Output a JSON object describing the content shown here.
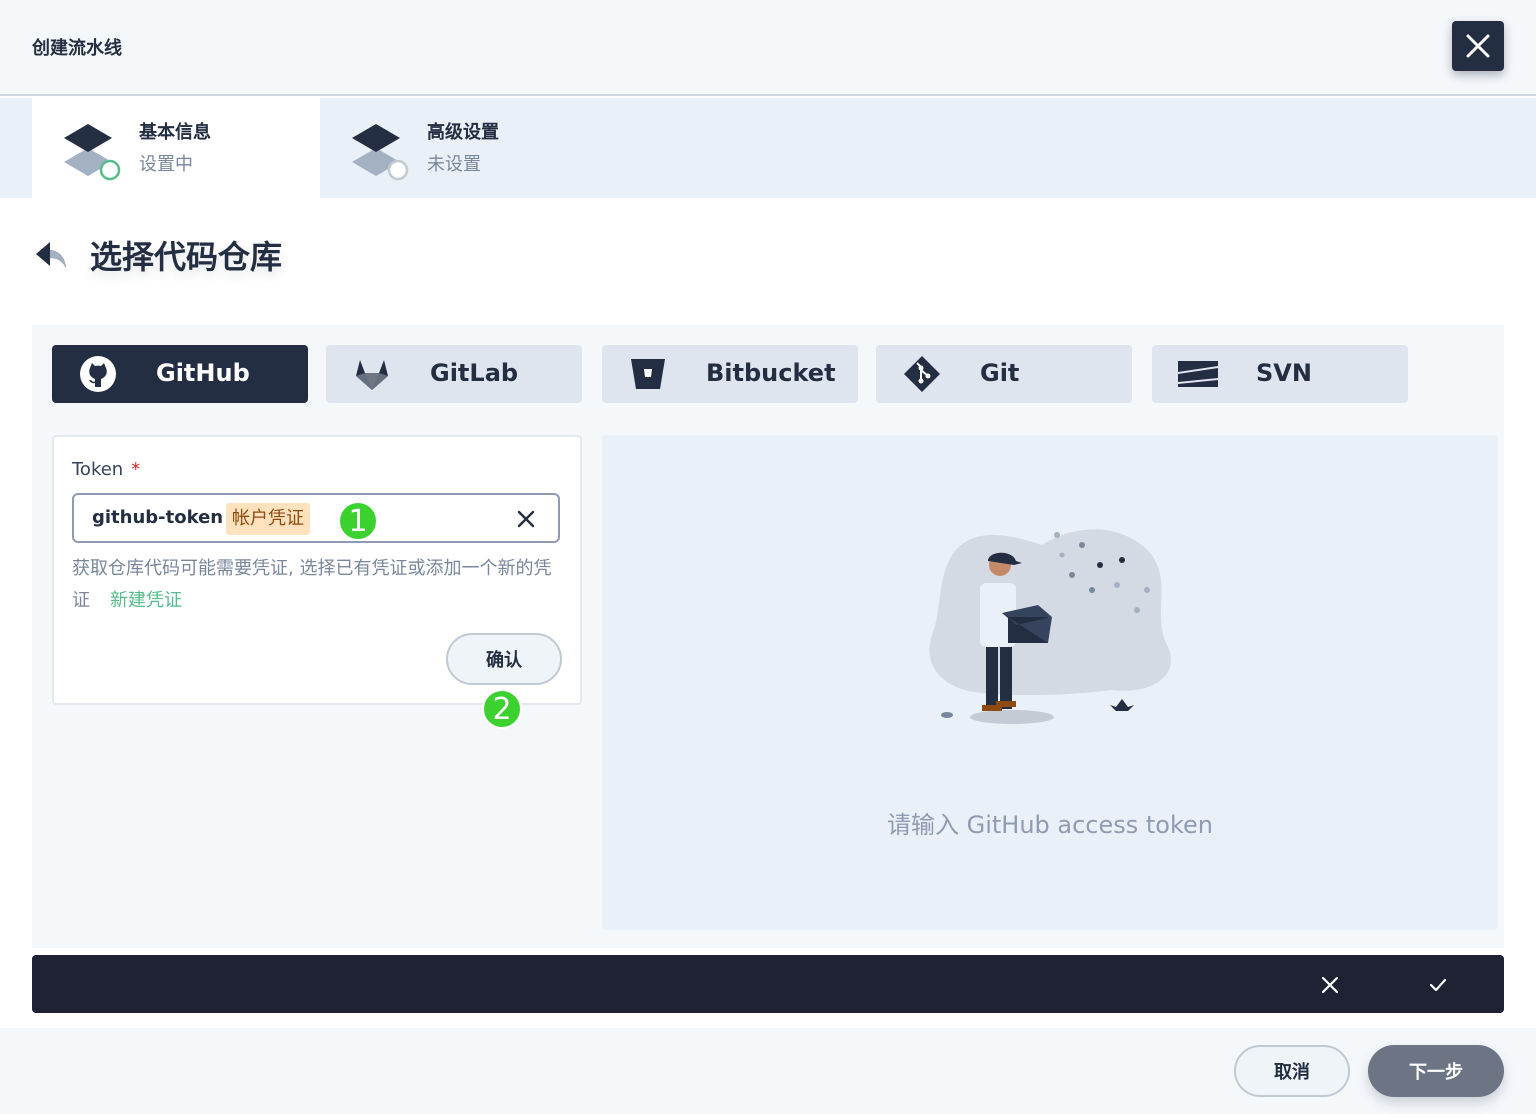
{
  "header": {
    "title": "创建流水线",
    "close_icon": "close-icon"
  },
  "steps": [
    {
      "title": "基本信息",
      "status": "设置中",
      "icon": "layers-icon",
      "state": "active"
    },
    {
      "title": "高级设置",
      "status": "未设置",
      "icon": "layers-icon",
      "state": "pending"
    }
  ],
  "page": {
    "title": "选择代码仓库",
    "back_icon": "back-arrow-icon"
  },
  "repo_tabs": [
    {
      "label": "GitHub",
      "icon": "github-icon",
      "selected": true
    },
    {
      "label": "GitLab",
      "icon": "gitlab-icon",
      "selected": false
    },
    {
      "label": "Bitbucket",
      "icon": "bitbucket-icon",
      "selected": false
    },
    {
      "label": "Git",
      "icon": "git-icon",
      "selected": false
    },
    {
      "label": "SVN",
      "icon": "svn-icon",
      "selected": false
    }
  ],
  "form": {
    "label": "Token",
    "required_mark": "*",
    "value": "github-token",
    "tag": "帐户凭证",
    "help": "获取仓库代码可能需要凭证, 选择已有凭证或添加一个新的凭证",
    "new_link": "新建凭证",
    "confirm": "确认"
  },
  "badges": [
    "1",
    "2"
  ],
  "preview": {
    "message": "请输入 GitHub access token"
  },
  "footer": {
    "cancel": "取消",
    "next": "下一步"
  },
  "colors": {
    "primary_dark": "#242e42",
    "panel_bg": "#f5f8fb",
    "tab_bg": "#dfe5ee",
    "link_green": "#55bc8a",
    "badge_green": "#3bd12f",
    "tag_bg": "#ffe1be"
  }
}
